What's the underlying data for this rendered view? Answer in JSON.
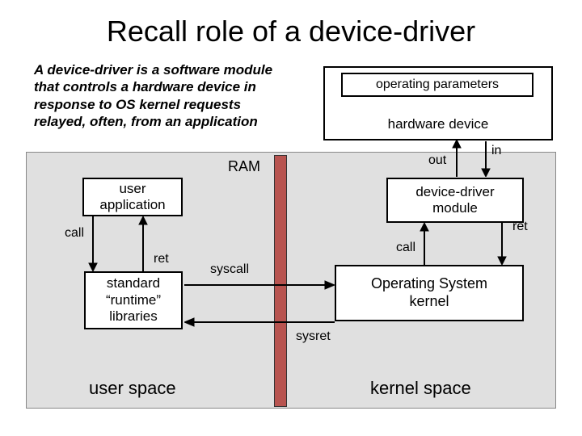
{
  "title": "Recall role of a device-driver",
  "description": "A device-driver is a software module that controls a hardware device in response to OS kernel requests relayed, often, from an application",
  "boxes": {
    "hardware_device": "hardware device",
    "operating_parameters": "operating parameters",
    "device_driver_module": "device-driver\nmodule",
    "os_kernel": "Operating System\nkernel",
    "user_application": "user\napplication",
    "runtime_libraries": "standard\n“runtime”\nlibraries"
  },
  "labels": {
    "ram": "RAM",
    "out": "out",
    "in": "in",
    "call_left": "call",
    "ret_left": "ret",
    "call_right": "call",
    "ret_right": "ret",
    "syscall": "syscall",
    "sysret": "sysret",
    "user_space": "user space",
    "kernel_space": "kernel space"
  }
}
